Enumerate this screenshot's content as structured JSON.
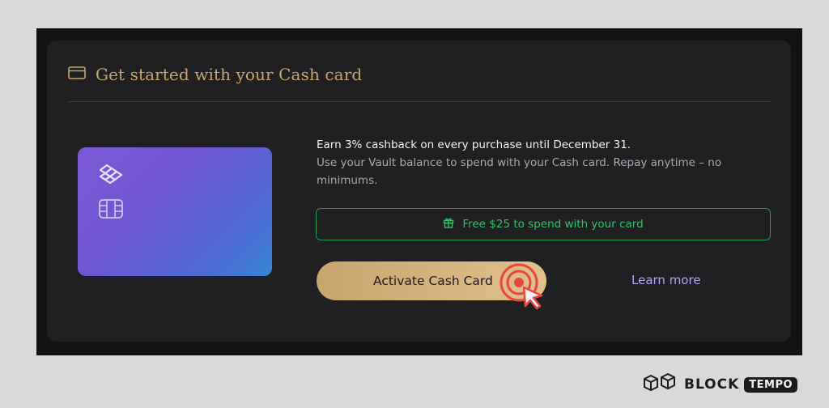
{
  "panel": {
    "title": "Get started with your Cash card",
    "title_icon": "card-icon"
  },
  "card": {
    "logo_icon": "vault-logo-icon",
    "chip_icon": "chip-icon",
    "gradient_colors": [
      "#7d5ad6",
      "#3487d2"
    ]
  },
  "offer": {
    "headline": "Earn 3% cashback on every purchase until December 31.",
    "description": "Use your Vault balance to spend with your Cash card. Repay anytime – no minimums."
  },
  "promo": {
    "icon": "gift-icon",
    "label": "Free $25 to spend with your card",
    "color": "#33c06b"
  },
  "actions": {
    "activate_label": "Activate Cash Card",
    "learn_more_label": "Learn more"
  },
  "click_indicator": {
    "icon": "cursor-click-icon",
    "color": "#e8473d"
  },
  "watermark": {
    "brand_left": "BLOCK",
    "brand_right": "TEMPO",
    "icon": "blocktempo-cube-icon"
  },
  "colors": {
    "accent_gold": "#c9a46b",
    "link_purple": "#b6a3ef",
    "panel_bg": "#202022"
  }
}
